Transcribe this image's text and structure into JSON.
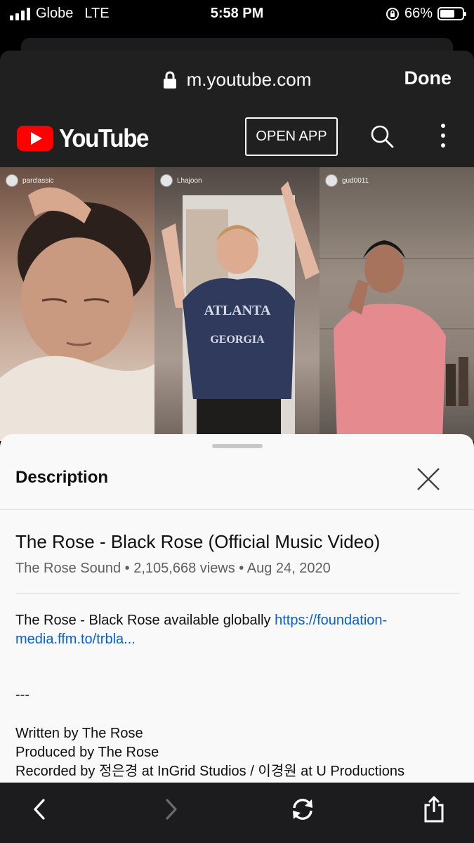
{
  "status_bar": {
    "carrier": "Globe",
    "network": "LTE",
    "time": "5:58 PM",
    "battery": "66%",
    "battery_level": 0.66
  },
  "safari": {
    "url": "m.youtube.com",
    "done_label": "Done"
  },
  "youtube": {
    "logo_text": "YouTube",
    "open_app_label": "OPEN APP",
    "brand_color": "#ff0000"
  },
  "video": {
    "handles": [
      "parclassic",
      "Lhajoon",
      "gud0011"
    ],
    "shirt_text": "ATLANTA\nEST 1837\nGEORGIA"
  },
  "description": {
    "header": "Description",
    "title": "The Rose - Black Rose (Official Music Video)",
    "meta": "The Rose Sound • 2,105,668 views • Aug 24, 2020",
    "body_prefix": "The Rose - Black Rose available globally ",
    "link_text": "https://foundation-media.ffm.to/trbla...",
    "dashes": "---",
    "credits": [
      "Written by The Rose",
      "Produced by The Rose",
      "Recorded by 정은경 at InGrid Studios / 이경원 at U Productions"
    ]
  },
  "icons": {
    "lock": "lock-icon",
    "search": "search-icon",
    "more": "more-vert-icon",
    "close": "close-icon",
    "back": "chevron-left-icon",
    "forward": "chevron-right-icon",
    "reload": "refresh-icon",
    "share": "share-icon"
  }
}
